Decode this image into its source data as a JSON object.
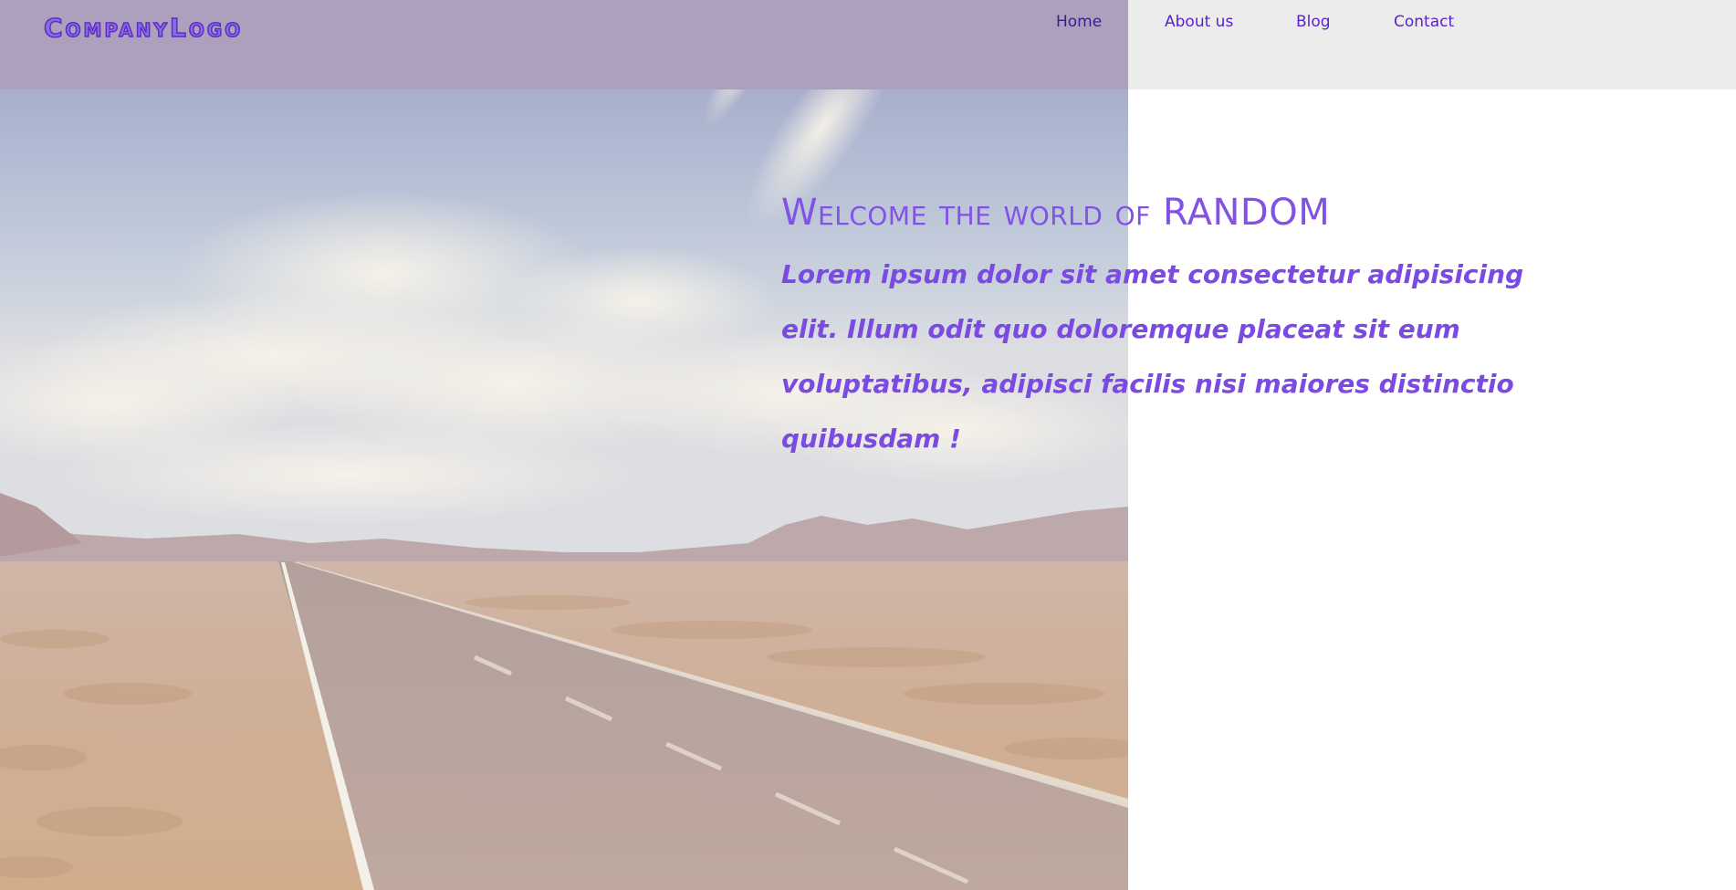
{
  "header": {
    "logo_text": "CompanyLogo",
    "nav": {
      "home": "Home",
      "about": "About us",
      "blog": "Blog",
      "contact": "Contact"
    }
  },
  "hero": {
    "title": "Welcome the world of RANDOM",
    "paragraph": "Lorem ipsum dolor sit amet consectetur adipisicing elit. Illum odit quo doloremque placeat sit eum voluptatibus, adipisci facilis nisi maiores distinctio quibusdam !",
    "image": "desert-road-photo"
  },
  "colors": {
    "accent": "#8252e6",
    "nav_text": "#5a22c9",
    "header_bg": "#ececec",
    "header_overlay": "#786296"
  }
}
